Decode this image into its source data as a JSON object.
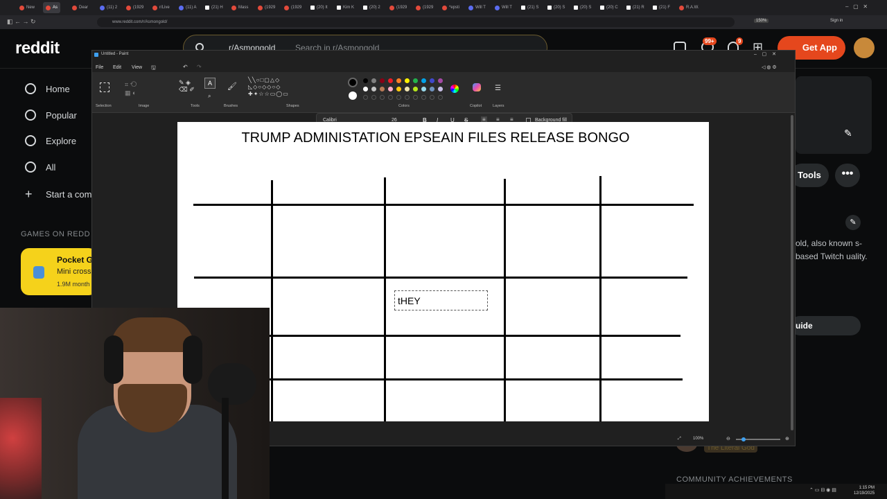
{
  "browser": {
    "tabs": [
      "New",
      "As",
      "Dear",
      "(11) 2",
      "(1929",
      "r/Live",
      "(11) A",
      "(21) H",
      "Mass",
      "(1929",
      "(1929",
      "(20) It",
      "Kim K",
      "(20) 2",
      "(1929",
      "(1929",
      "*epsti",
      "Will T",
      "Will T",
      "(21) S",
      "(20) S",
      "(20) S",
      "(20) C",
      "(21) R",
      "(21) F",
      "R.A.W."
    ],
    "url": "www.reddit.com/r/Asmongold/",
    "zoom": "150%",
    "signin": "Sign in"
  },
  "reddit": {
    "logo": "reddit",
    "search_sub": "r/Asmongold",
    "search_placeholder": "Search in r/Asmongold",
    "get_app": "Get App",
    "badge_inbox": "99+",
    "badge_notif": "9",
    "nav": [
      "Home",
      "Popular",
      "Explore",
      "All",
      "Start a com"
    ],
    "games_heading": "GAMES ON REDD",
    "game_title": "Pocket G",
    "game_sub": "Mini cross",
    "game_stat": "1.9M month",
    "tools": "Tools",
    "more": "•••",
    "sidebar_desc": "old, also known s-based Twitch uality.",
    "guide": "uide",
    "mod_name": "The Literal God",
    "community_achievements": "COMMUNITY ACHIEVEMENTS"
  },
  "paint": {
    "title": "Untitled - Paint",
    "menu": [
      "File",
      "Edit",
      "View"
    ],
    "ribbon_labels": [
      "Selection",
      "Image",
      "Tools",
      "Brushes",
      "Shapes",
      "Colors",
      "Copilot",
      "Layers"
    ],
    "font_name": "Calibri",
    "font_size": "26",
    "background_fill": "Background fill",
    "canvas_title": "TRUMP ADMINISTATION EPSEAIN FILES RELEASE BONGO",
    "text_box_value": "tHEY",
    "zoom_level": "100%",
    "palette": [
      "#000000",
      "#7f7f7f",
      "#880015",
      "#ed1c24",
      "#ff7f27",
      "#fff200",
      "#22b14c",
      "#00a2e8",
      "#3f48cc",
      "#a349a4",
      "#ffffff",
      "#c3c3c3",
      "#b97a57",
      "#ffaec9",
      "#ffc90e",
      "#efe4b0",
      "#b5e61d",
      "#99d9ea",
      "#7092be",
      "#c8bfe7"
    ]
  },
  "taskbar": {
    "time": "1:15 PM",
    "date": "12/19/2025"
  }
}
